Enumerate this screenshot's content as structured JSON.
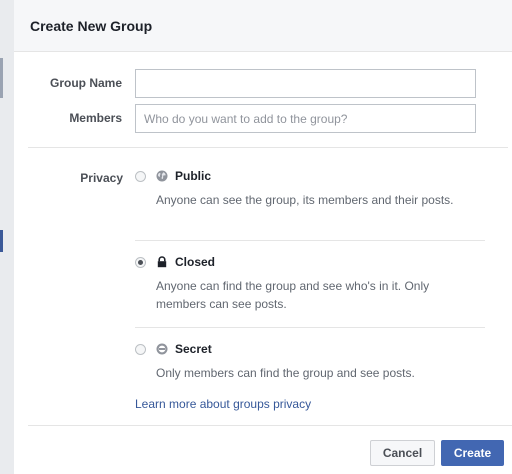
{
  "dialog": {
    "title": "Create New Group"
  },
  "form": {
    "group_name": {
      "label": "Group Name",
      "value": "",
      "placeholder": ""
    },
    "members": {
      "label": "Members",
      "value": "",
      "placeholder": "Who do you want to add to the group?"
    }
  },
  "privacy": {
    "label": "Privacy",
    "selected": "closed",
    "options": [
      {
        "id": "public",
        "name": "Public",
        "icon": "globe-icon",
        "description": "Anyone can see the group, its members and their posts.",
        "checked": false
      },
      {
        "id": "closed",
        "name": "Closed",
        "icon": "lock-icon",
        "description": "Anyone can find the group and see who's in it. Only members can see posts.",
        "checked": true
      },
      {
        "id": "secret",
        "name": "Secret",
        "icon": "secret-icon",
        "description": "Only members can find the group and see posts.",
        "checked": false
      }
    ],
    "learn_more": "Learn more about groups privacy"
  },
  "footer": {
    "cancel_label": "Cancel",
    "create_label": "Create"
  },
  "colors": {
    "primary": "#4267b2",
    "link": "#365899",
    "header_bg": "#f6f7f9"
  }
}
